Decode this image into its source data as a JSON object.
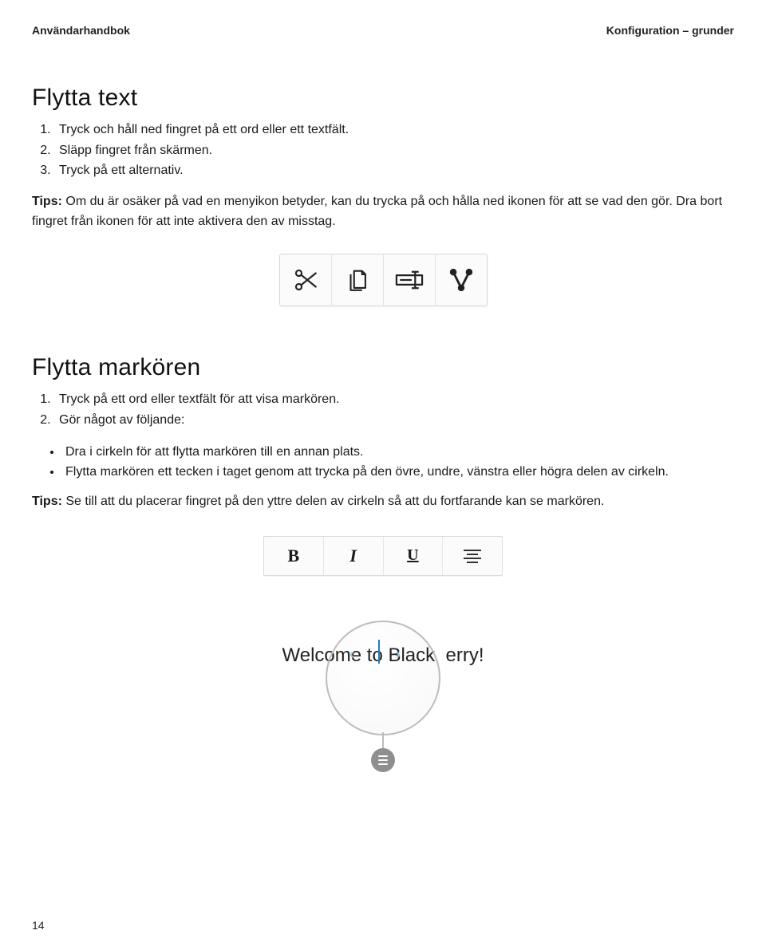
{
  "header": {
    "left": "Användarhandbok",
    "right": "Konfiguration – grunder"
  },
  "section1": {
    "title": "Flytta text",
    "steps": [
      "Tryck och håll ned fingret på ett ord eller ett textfält.",
      "Släpp fingret från skärmen.",
      "Tryck på ett alternativ."
    ],
    "tip_label": "Tips:",
    "tip_text": " Om du är osäker på vad en menyikon betyder, kan du trycka på och hålla ned ikonen för att se vad den gör. Dra bort fingret från ikonen för att inte aktivera den av misstag."
  },
  "toolbar1_icons": {
    "cut": "cut-icon",
    "copy": "copy-icon",
    "rename": "rename-icon",
    "share": "share-icon"
  },
  "section2": {
    "title": "Flytta markören",
    "steps": [
      "Tryck på ett ord eller textfält för att visa markören.",
      "Gör något av följande:"
    ],
    "bullets": [
      "Dra i cirkeln för att flytta markören till en annan plats.",
      "Flytta markören ett tecken i taget genom att trycka på den övre, undre, vänstra eller högra delen av cirkeln."
    ],
    "tip_label": "Tips:",
    "tip_text": " Se till att du placerar fingret på den yttre delen av cirkeln så att du fortfarande kan se markören."
  },
  "figure2": {
    "bold": "B",
    "italic": "I",
    "underline": "U",
    "sample_left": "Welcome",
    "sample_mid": "to Black",
    "sample_right": "erry!"
  },
  "page_number": "14"
}
